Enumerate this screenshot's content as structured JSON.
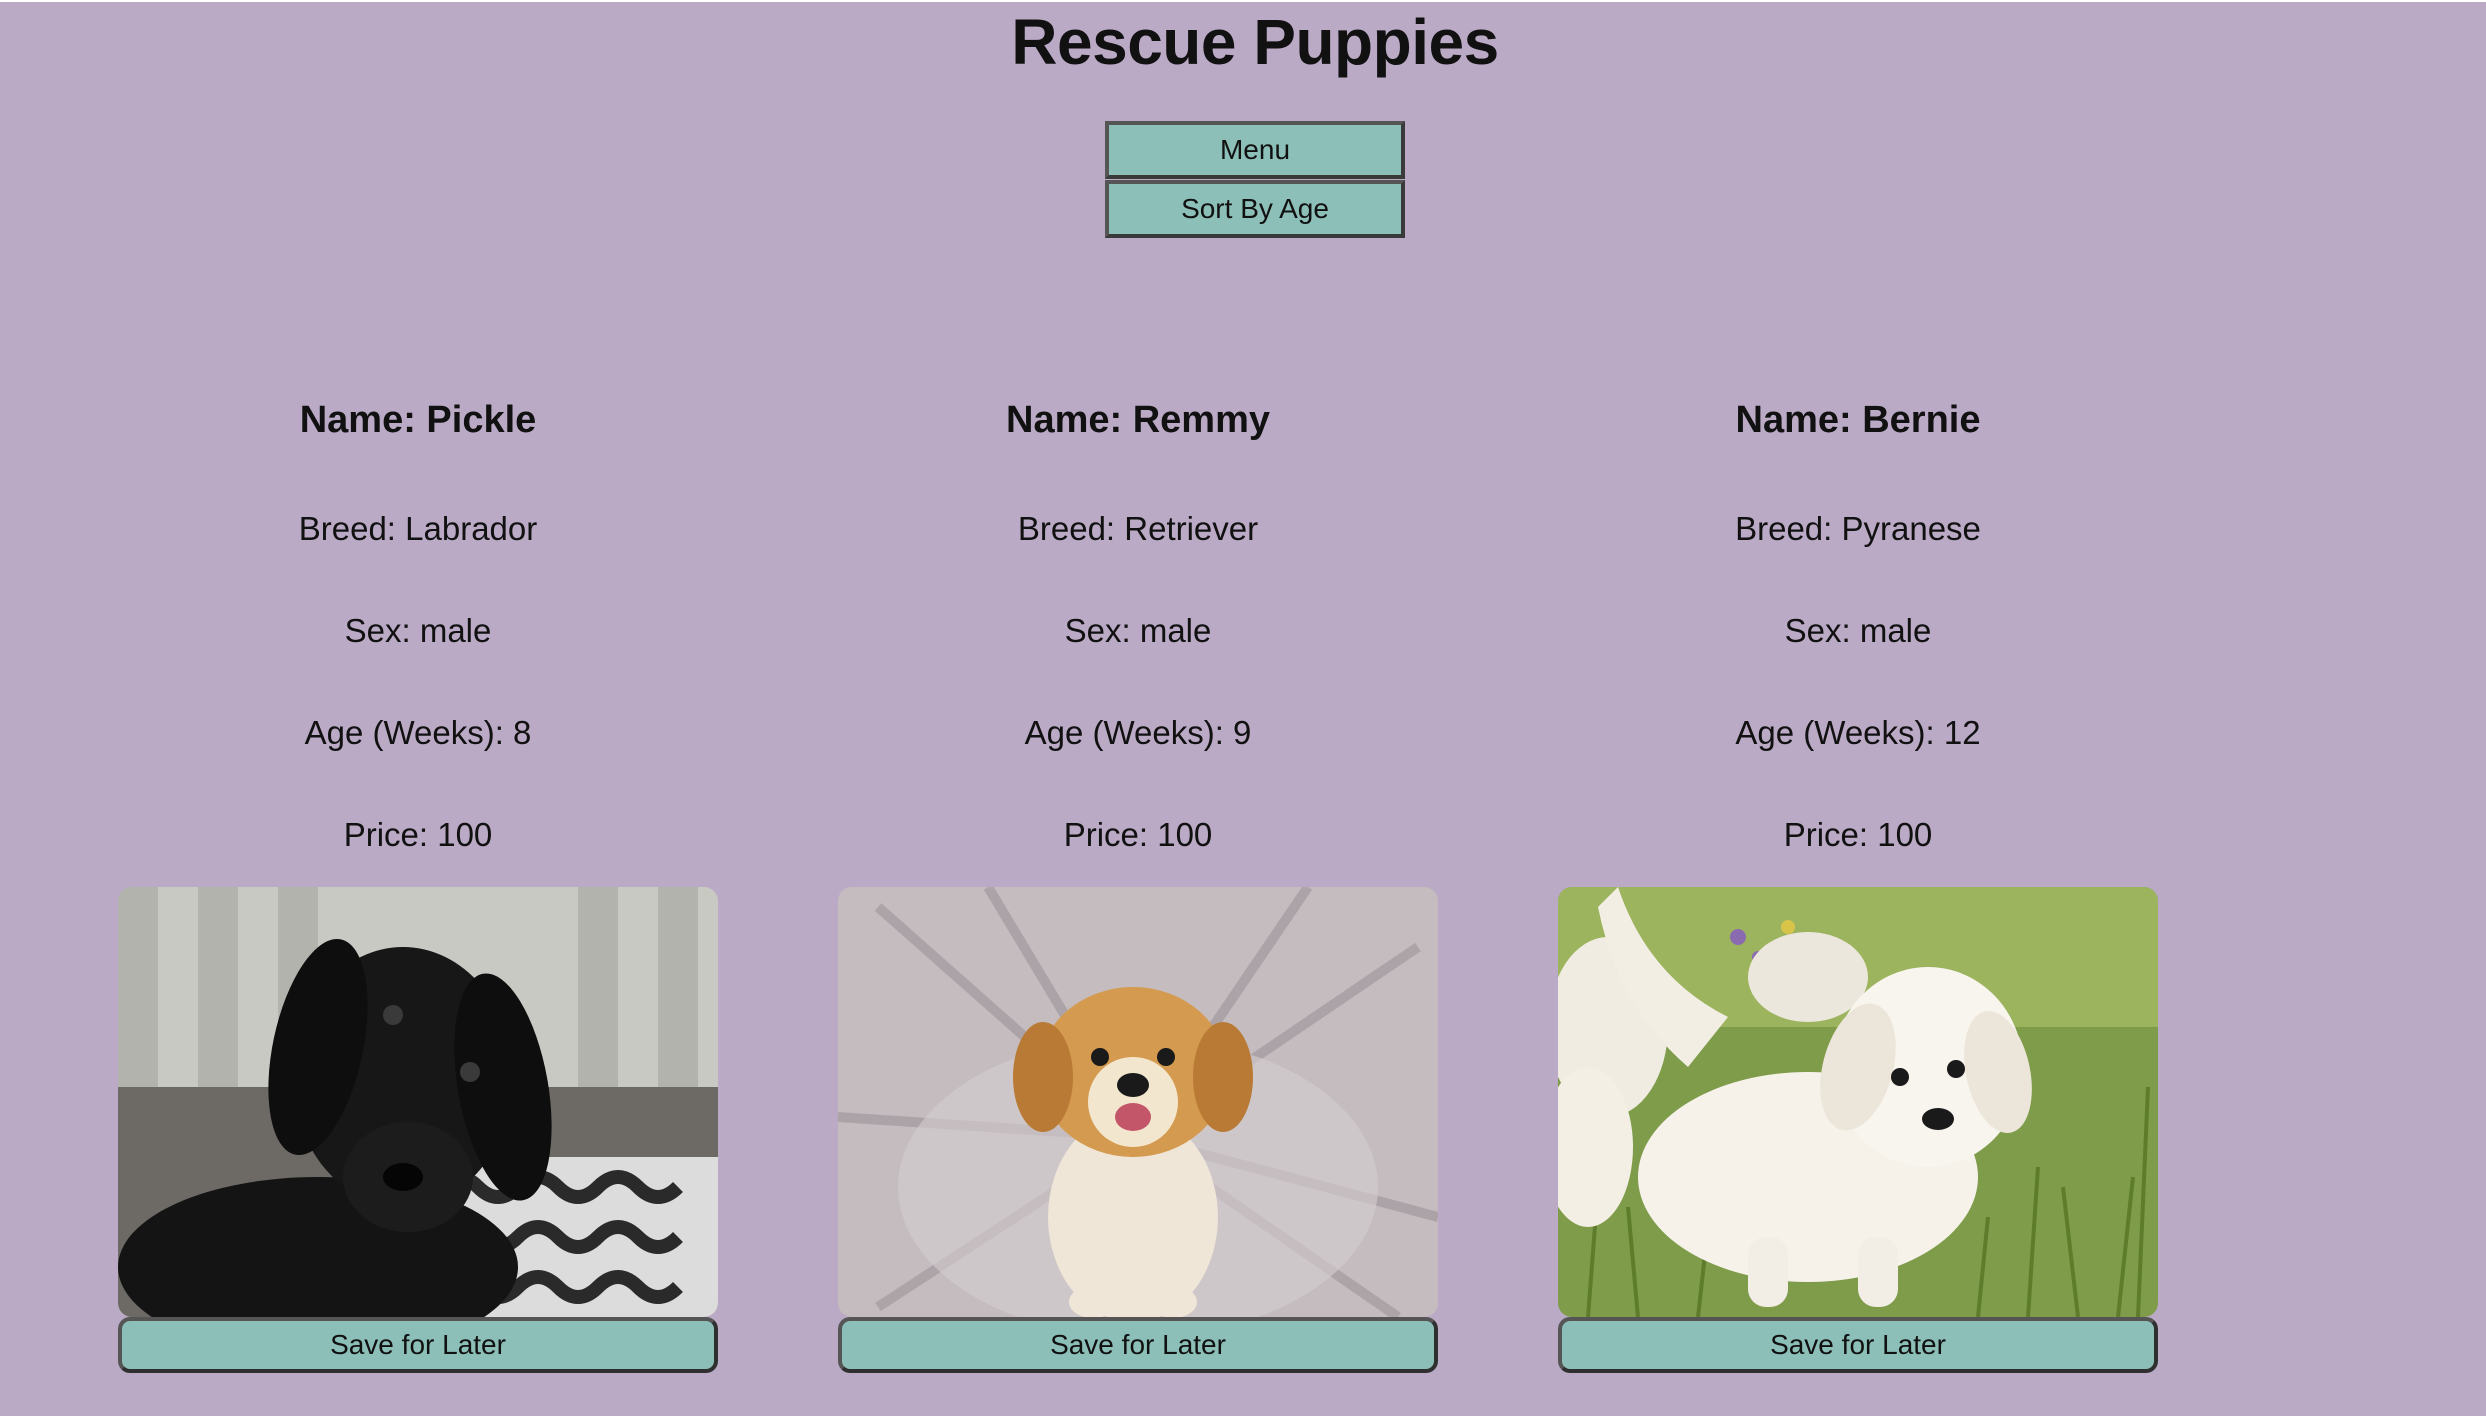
{
  "header": {
    "title": "Rescue Puppies"
  },
  "controls": {
    "menu_label": "Menu",
    "sort_label": "Sort By Age"
  },
  "puppies": [
    {
      "name": "Name: Pickle",
      "breed": "Breed: Labrador",
      "sex": "Sex: male",
      "age": "Age (Weeks): 8",
      "price": "Price: 100",
      "photo": "black-labrador-puppy-photo",
      "save_label": "Save for Later"
    },
    {
      "name": "Name: Remmy",
      "breed": "Breed: Retriever",
      "sex": "Sex: male",
      "age": "Age (Weeks): 9",
      "price": "Price: 100",
      "photo": "golden-retriever-puppy-photo",
      "save_label": "Save for Later"
    },
    {
      "name": "Name: Bernie",
      "breed": "Breed: Pyranese",
      "sex": "Sex: male",
      "age": "Age (Weeks): 12",
      "price": "Price: 100",
      "photo": "white-puppy-in-grass-photo",
      "save_label": "Save for Later"
    }
  ],
  "colors": {
    "background": "#bbaac6",
    "button": "#8cbfb8",
    "button_border": "#555555"
  }
}
